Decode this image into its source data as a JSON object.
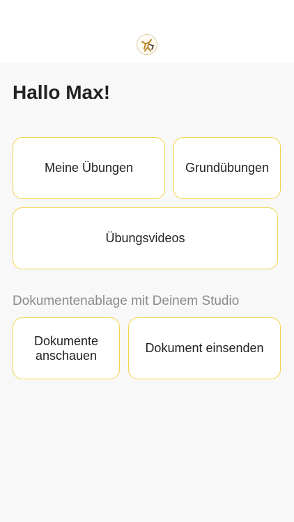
{
  "greeting": "Hallo Max!",
  "tiles": {
    "meine_uebungen": "Meine Übungen",
    "grunduebungen": "Grundübungen",
    "uebungsvideos": "Übungsvideos"
  },
  "documents": {
    "section_label": "Dokumentenablage mit Deinem Studio",
    "view_line1": "Dokumente",
    "view_line2": "anschauen",
    "send": "Dokument einsenden"
  },
  "colors": {
    "accent_border": "#f2d34b",
    "background": "#f8f8f8",
    "logo_gold": "#c9a44a"
  },
  "icons": {
    "logo": "studio-logo-icon"
  }
}
